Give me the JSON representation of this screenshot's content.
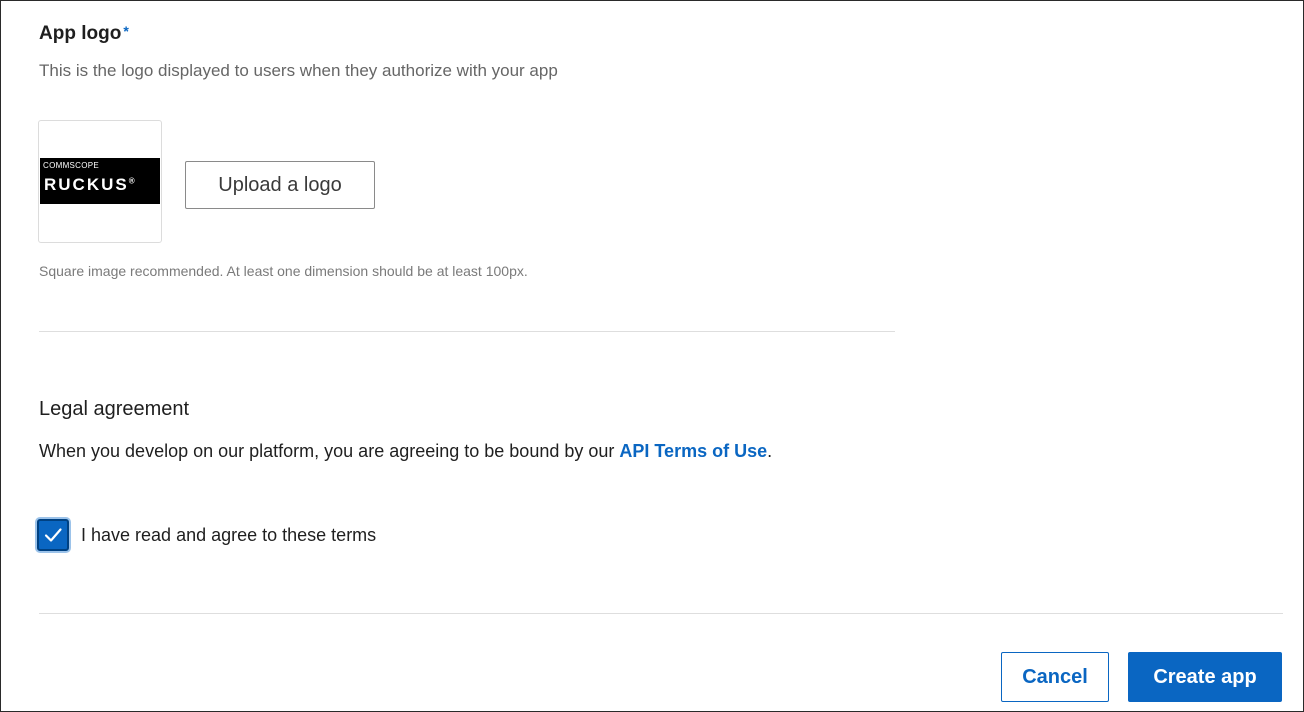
{
  "app_logo": {
    "title": "App logo",
    "required_mark": "*",
    "subtitle": "This is the logo displayed to users when they authorize with your app",
    "logo": {
      "top_text": "COMMSCOPE",
      "brand_text": "RUCKUS",
      "registered_mark": "®"
    },
    "upload_label": "Upload a logo",
    "hint": "Square image recommended. At least one dimension should be at least 100px."
  },
  "legal": {
    "title": "Legal agreement",
    "text_before_link": "When you develop on our platform, you are agreeing to be bound by our ",
    "link_text": "API Terms of Use",
    "text_after_link": ".",
    "agree_label": "I have read and agree to these terms",
    "agree_checked": true
  },
  "footer": {
    "cancel_label": "Cancel",
    "create_label": "Create app"
  },
  "colors": {
    "accent": "#0a66c2",
    "text": "#1f1f1f",
    "muted": "#666666"
  }
}
